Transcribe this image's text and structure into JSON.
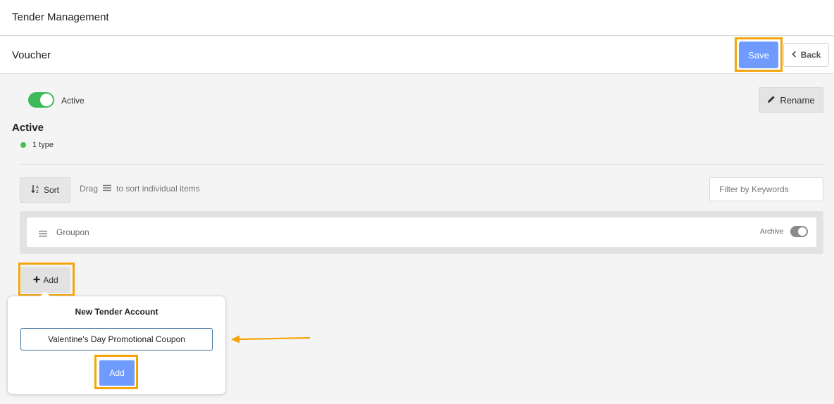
{
  "app": {
    "title": "Tender Management"
  },
  "page": {
    "title": "Voucher"
  },
  "toolbar": {
    "save_label": "Save",
    "back_label": "Back"
  },
  "status_toggle": {
    "label": "Active",
    "on": true
  },
  "rename": {
    "label": "Rename"
  },
  "summary": {
    "heading": "Active",
    "count_text": "1 type"
  },
  "sort": {
    "label": "Sort",
    "hint_prefix": "Drag",
    "hint_suffix": "to sort individual items"
  },
  "filter": {
    "placeholder": "Filter by Keywords",
    "value": ""
  },
  "items": [
    {
      "name": "Groupon",
      "archive_label": "Archive",
      "archive_on": true
    }
  ],
  "add": {
    "label": "Add"
  },
  "popover": {
    "title": "New Tender Account",
    "input_value": "Valentine's Day Promotional Coupon",
    "add_label": "Add"
  },
  "colors": {
    "accent": "#6f9bff",
    "highlight": "#f5a50b",
    "toggle_on": "#3fba5b",
    "status_dot": "#48c04a"
  },
  "icons": {
    "back": "chevron-left-icon",
    "rename": "pencil-icon",
    "sort": "sort-icon",
    "drag": "drag-handle-icon",
    "add": "plus-icon"
  }
}
